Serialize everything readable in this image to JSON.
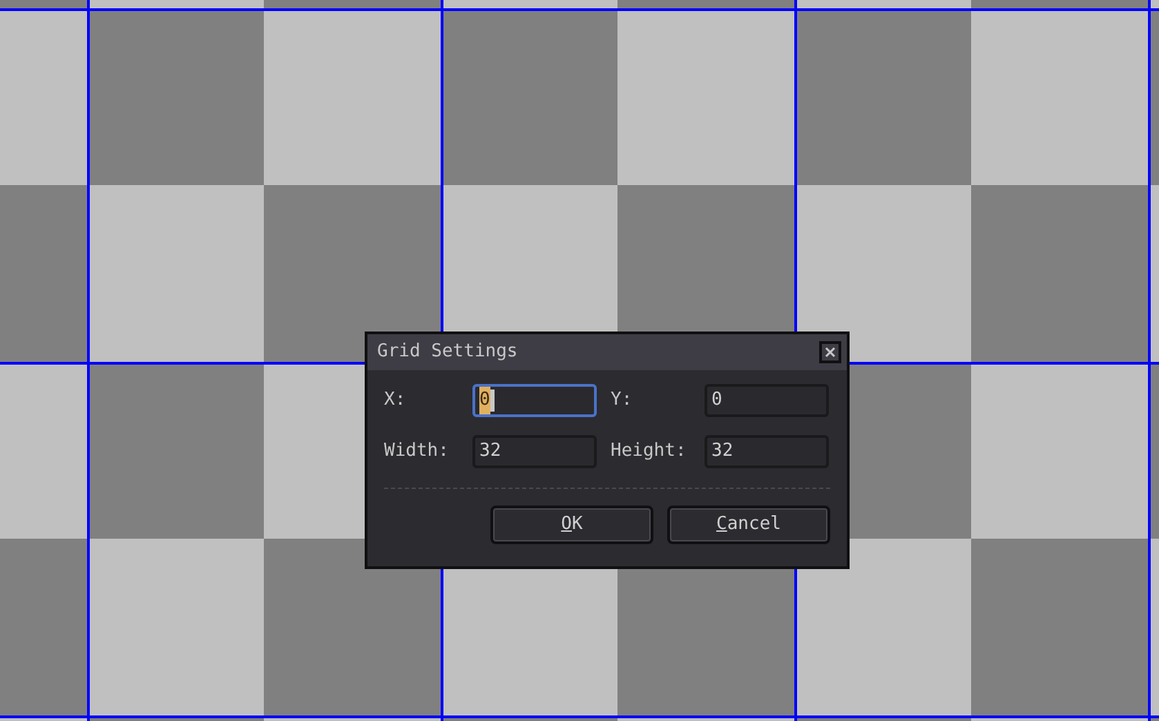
{
  "dialog": {
    "title": "Grid Settings",
    "fields": [
      {
        "label": "X:",
        "value": "0",
        "focused": true
      },
      {
        "label": "Y:",
        "value": "0",
        "focused": false
      },
      {
        "label": "Width:",
        "value": "32",
        "focused": false
      },
      {
        "label": "Height:",
        "value": "32",
        "focused": false
      }
    ],
    "buttons": [
      {
        "label": "OK"
      },
      {
        "label": "Cancel"
      }
    ]
  }
}
